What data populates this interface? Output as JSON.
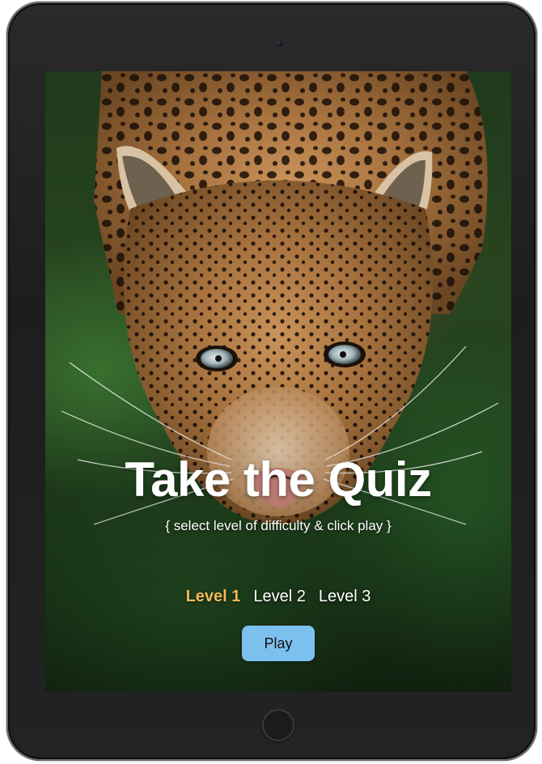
{
  "quiz": {
    "title": "Take the Quiz",
    "subtitle": "{ select level of difficulty & click play }",
    "levels": [
      {
        "label": "Level 1",
        "selected": true
      },
      {
        "label": "Level 2",
        "selected": false
      },
      {
        "label": "Level 3",
        "selected": false
      }
    ],
    "play_label": "Play"
  },
  "colors": {
    "active_level": "#f2b85a",
    "play_button": "#7cc0ef",
    "device_frame": "#1f1f1f"
  },
  "background_image": {
    "subject": "leopard-face"
  }
}
